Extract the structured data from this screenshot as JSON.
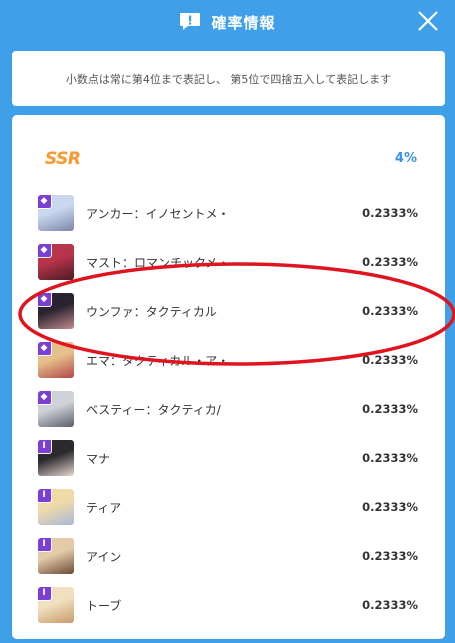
{
  "header": {
    "title": "確率情報",
    "icon": "chat-exclamation-icon",
    "close_icon": "close-icon"
  },
  "notice": {
    "text": "小数点は常に第4位まで表記し、 第5位で四捨五入して表記します"
  },
  "rarity": {
    "label": "SSR",
    "rate": "4%"
  },
  "items": [
    {
      "name": "アンカー：イノセントメ・",
      "rate": "0.2333%",
      "badge": "◆",
      "colors": [
        "#c9d7ef",
        "#7c86a8"
      ]
    },
    {
      "name": "マスト：ロマンチックメ・",
      "rate": "0.2333%",
      "badge": "◆",
      "colors": [
        "#b8344a",
        "#4a1a24"
      ]
    },
    {
      "name": "ウンファ：タクティカル",
      "rate": "0.2333%",
      "badge": "◆",
      "colors": [
        "#2a2230",
        "#c28a8c"
      ]
    },
    {
      "name": "エマ：タクティカル・ア・",
      "rate": "0.2333%",
      "badge": "◆",
      "colors": [
        "#e6c08a",
        "#b0474a"
      ]
    },
    {
      "name": "ベスティー：タクティカ/",
      "rate": "0.2333%",
      "badge": "◆",
      "colors": [
        "#cfd2d8",
        "#5a5e6a"
      ]
    },
    {
      "name": "マナ",
      "rate": "0.2333%",
      "badge": "I",
      "colors": [
        "#2a2a2e",
        "#e8d8d0"
      ]
    },
    {
      "name": "ティア",
      "rate": "0.2333%",
      "badge": "I",
      "colors": [
        "#f0dba8",
        "#a9b8d8"
      ]
    },
    {
      "name": "アイン",
      "rate": "0.2333%",
      "badge": "I",
      "colors": [
        "#e4cba8",
        "#6a4a3a"
      ]
    },
    {
      "name": "トーブ",
      "rate": "0.2333%",
      "badge": "I",
      "colors": [
        "#f0e0c0",
        "#c89a6a"
      ]
    }
  ],
  "annotation": {
    "color": "#e0141e"
  }
}
